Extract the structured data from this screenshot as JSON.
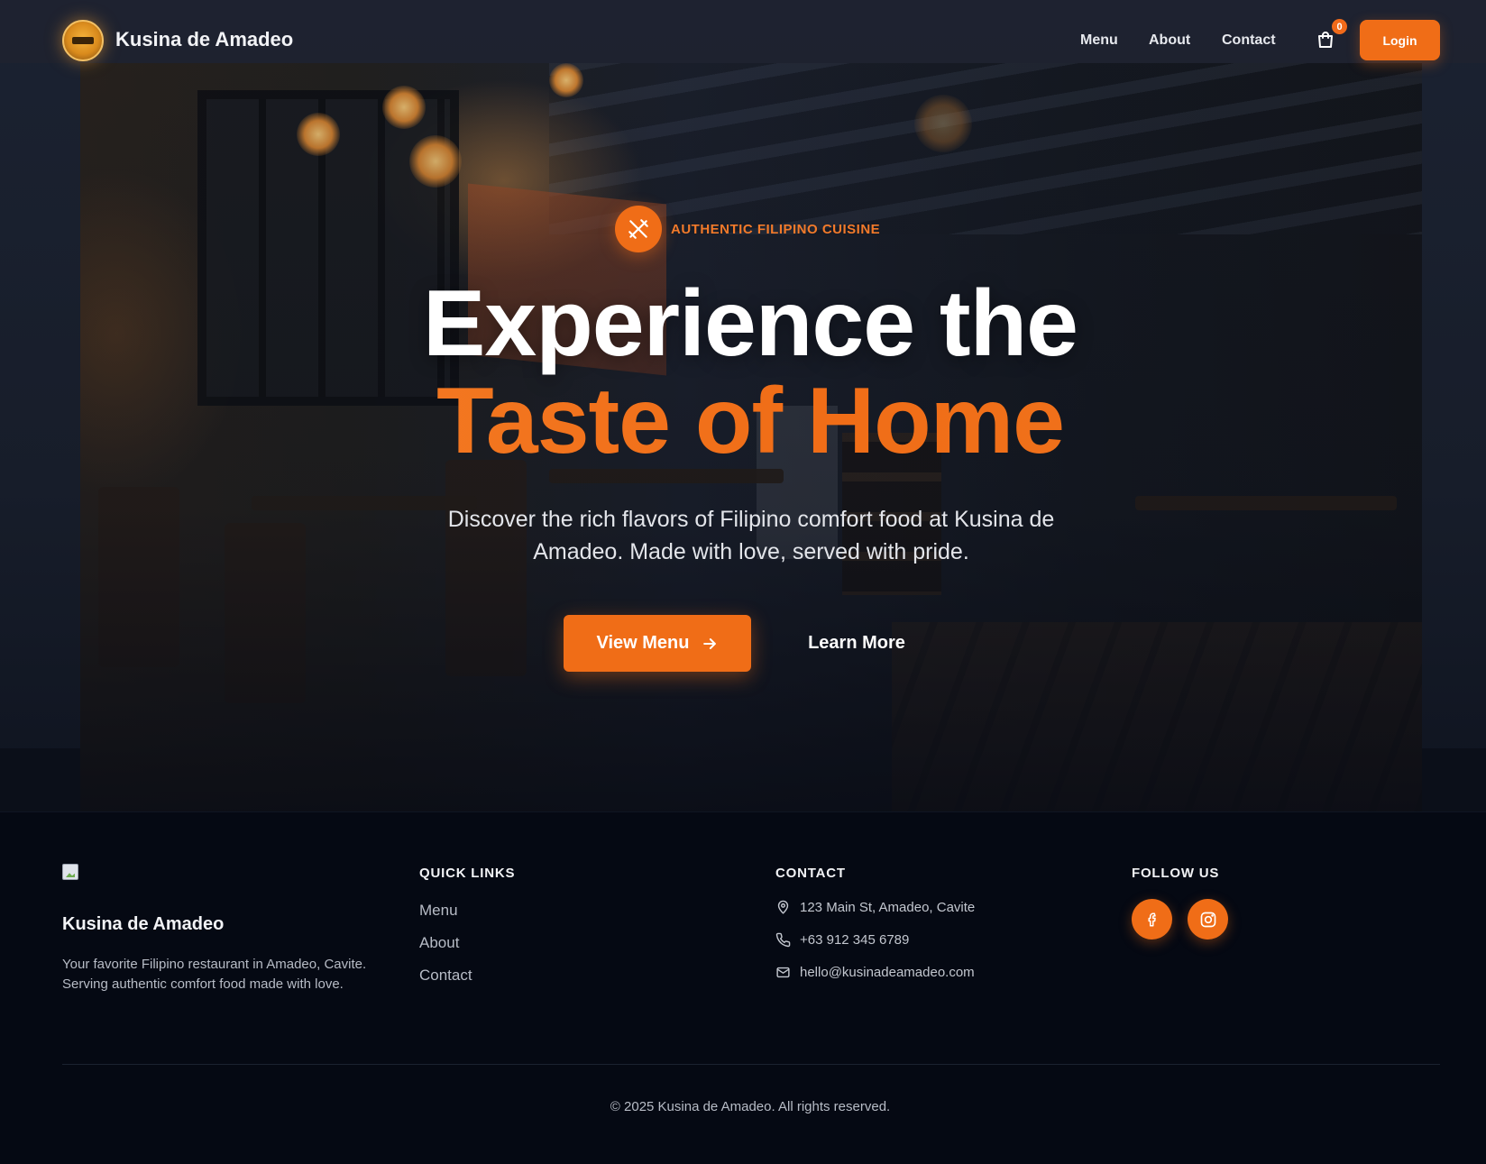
{
  "nav": {
    "brand": "Kusina de Amadeo",
    "links": [
      "Menu",
      "About",
      "Contact"
    ],
    "cart_count": "0",
    "login_label": "Login"
  },
  "hero": {
    "eyebrow": "AUTHENTIC FILIPINO CUISINE",
    "headline_line1": "Experience the",
    "headline_line2": "Taste of Home",
    "subtitle": "Discover the rich flavors of Filipino comfort food at Kusina de Amadeo. Made with love, served with pride.",
    "primary_cta": "View Menu",
    "secondary_cta": "Learn More"
  },
  "footer": {
    "brand": "Kusina de Amadeo",
    "description": "Your favorite Filipino restaurant in Amadeo, Cavite. Serving authentic comfort food made with love.",
    "quick_links_heading": "QUICK LINKS",
    "quick_links": [
      "Menu",
      "About",
      "Contact"
    ],
    "contact_heading": "CONTACT",
    "contact": {
      "address": "123 Main St, Amadeo, Cavite",
      "phone": "+63 912 345 6789",
      "email": "hello@kusinadeamadeo.com"
    },
    "follow_heading": "FOLLOW US",
    "social_icons": [
      "facebook-icon",
      "instagram-icon"
    ],
    "copyright": "© 2025 Kusina de Amadeo. All rights reserved."
  },
  "colors": {
    "accent": "#f06d17",
    "background": "#050913",
    "navbar": "#1e2330"
  }
}
